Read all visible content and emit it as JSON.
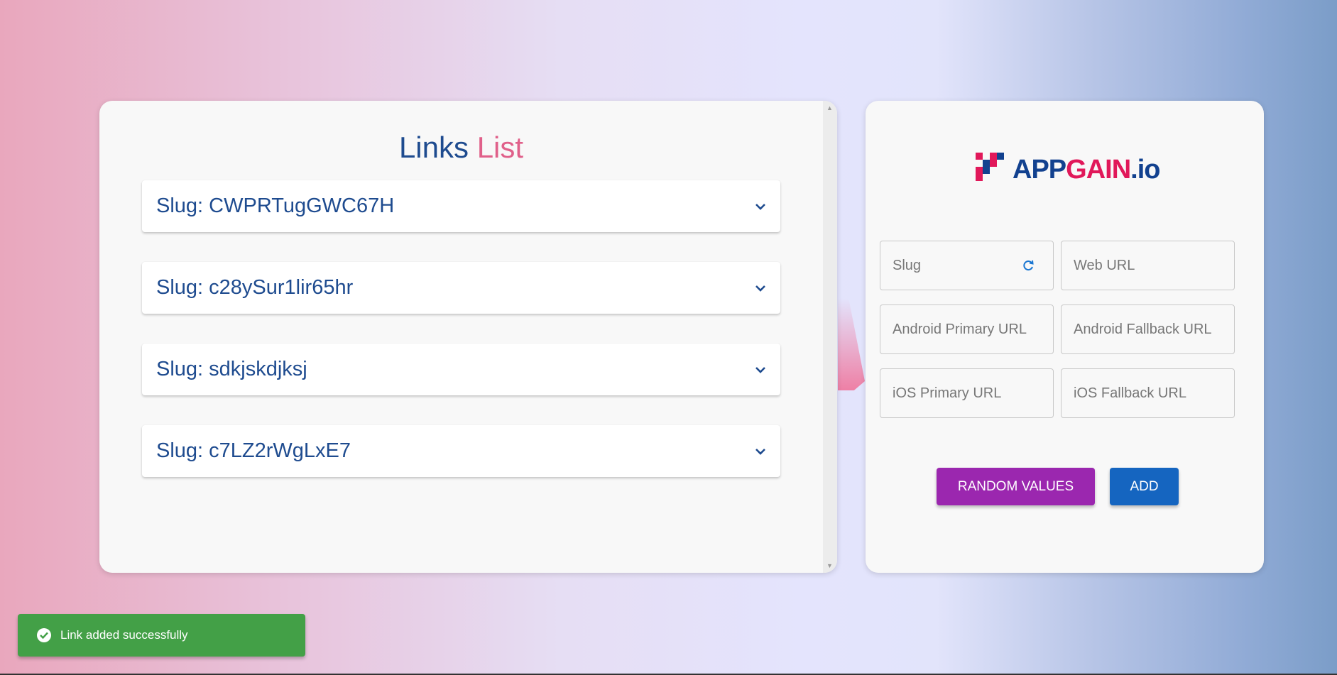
{
  "links_panel": {
    "title_part1": "Links",
    "title_part2": "List",
    "items": [
      {
        "label": "Slug: CWPRTugGWC67H"
      },
      {
        "label": "Slug: c28ySur1lir65hr"
      },
      {
        "label": "Slug: sdkjskdjksj"
      },
      {
        "label": "Slug: c7LZ2rWgLxE7"
      }
    ]
  },
  "form": {
    "logo": {
      "part1": "APP",
      "part2": "GAIN",
      "part3": ".io"
    },
    "fields": {
      "slug": {
        "placeholder": "Slug",
        "value": ""
      },
      "web_url": {
        "placeholder": "Web URL",
        "value": ""
      },
      "android_primary": {
        "placeholder": "Android Primary URL",
        "value": ""
      },
      "android_fallback": {
        "placeholder": "Android Fallback URL",
        "value": ""
      },
      "ios_primary": {
        "placeholder": "iOS Primary URL",
        "value": ""
      },
      "ios_fallback": {
        "placeholder": "iOS Fallback URL",
        "value": ""
      }
    },
    "random_button": "RANDOM VALUES",
    "add_button": "ADD"
  },
  "snackbar": {
    "message": "Link added successfully"
  },
  "colors": {
    "primary_text": "#1e4b8f",
    "accent_pink": "#e0608a",
    "random_button": "#9b27af",
    "add_button": "#1565c0",
    "success": "#43a047"
  }
}
